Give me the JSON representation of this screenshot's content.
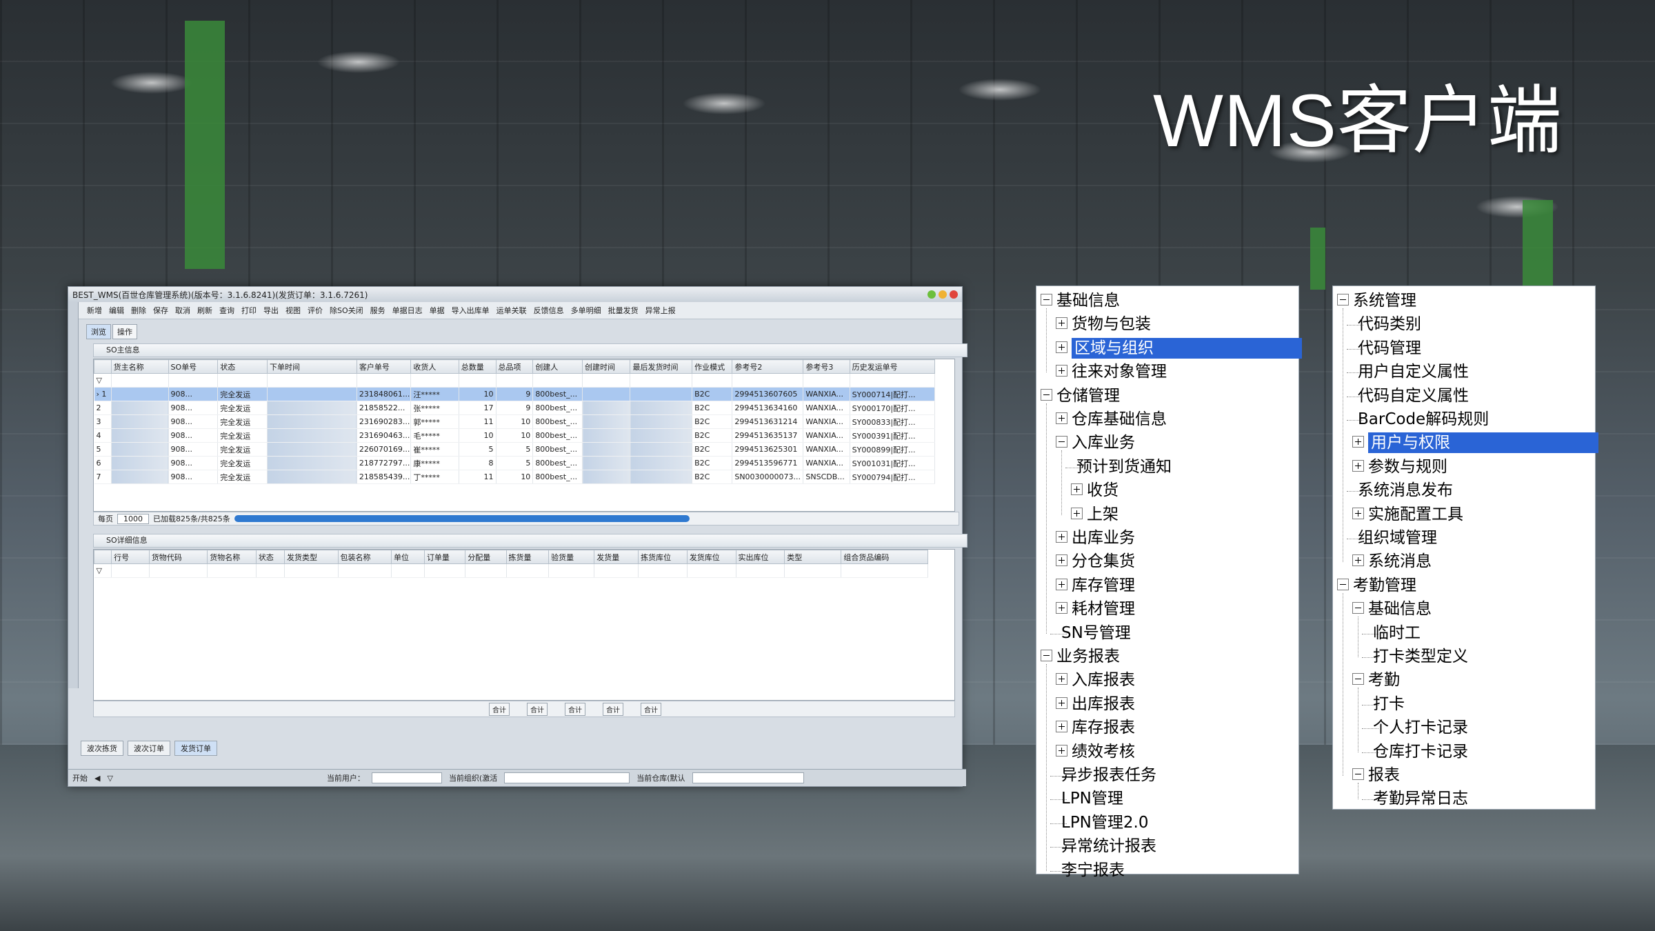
{
  "headline": "WMS客户端",
  "app": {
    "title": "BEST_WMS(百世仓库管理系统)(版本号：3.1.6.8241)(发货订单：3.1.6.7261)",
    "toolbar": [
      "新增",
      "编辑",
      "删除",
      "保存",
      "取消",
      "刷新",
      "查询",
      "打印",
      "导出",
      "视图",
      "评价",
      "除SO关闭",
      "服务",
      "单据日志",
      "单据",
      "导入出库单",
      "运单关联",
      "反馈信息",
      "多单明细",
      "批量发货",
      "异常上报"
    ],
    "subtabs": [
      "浏览",
      "操作"
    ],
    "so_header_section": "SO主信息",
    "so_columns": [
      "",
      "货主名称",
      "SO单号",
      "状态",
      "下单时间",
      "客户单号",
      "收货人",
      "总数量",
      "总品项",
      "创建人",
      "创建时间",
      "最后发货时间",
      "作业模式",
      "参考号2",
      "参考号3",
      "历史发运单号"
    ],
    "so_rows": [
      {
        "idx": "1",
        "so": "908...",
        "status": "完全发运",
        "cust": "231848061...",
        "recv": "汪*****",
        "qty": "10",
        "items": "9",
        "creator": "800best_...",
        "mode": "B2C",
        "ref2": "2994513607605",
        "ref3": "WANXIA...",
        "hist": "SY000714|配打..."
      },
      {
        "idx": "2",
        "so": "908...",
        "status": "完全发运",
        "cust": "21858522...",
        "recv": "张*****",
        "qty": "17",
        "items": "9",
        "creator": "800best_...",
        "mode": "B2C",
        "ref2": "2994513634160",
        "ref3": "WANXIA...",
        "hist": "SY000170|配打..."
      },
      {
        "idx": "3",
        "so": "908...",
        "status": "完全发运",
        "cust": "231690283...",
        "recv": "郭*****",
        "qty": "11",
        "items": "10",
        "creator": "800best_...",
        "mode": "B2C",
        "ref2": "2994513631214",
        "ref3": "WANXIA...",
        "hist": "SY000833|配打..."
      },
      {
        "idx": "4",
        "so": "908...",
        "status": "完全发运",
        "cust": "231690463...",
        "recv": "毛*****",
        "qty": "10",
        "items": "10",
        "creator": "800best_...",
        "mode": "B2C",
        "ref2": "2994513635137",
        "ref3": "WANXIA...",
        "hist": "SY000391|配打..."
      },
      {
        "idx": "5",
        "so": "908...",
        "status": "完全发运",
        "cust": "226070169...",
        "recv": "崔*****",
        "qty": "5",
        "items": "5",
        "creator": "800best_...",
        "mode": "B2C",
        "ref2": "2994513625301",
        "ref3": "WANXIA...",
        "hist": "SY000899|配打..."
      },
      {
        "idx": "6",
        "so": "908...",
        "status": "完全发运",
        "cust": "218772797...",
        "recv": "康*****",
        "qty": "8",
        "items": "5",
        "creator": "800best_...",
        "mode": "B2C",
        "ref2": "2994513596771",
        "ref3": "WANXIA...",
        "hist": "SY001031|配打..."
      },
      {
        "idx": "7",
        "so": "908...",
        "status": "完全发运",
        "cust": "218585439...",
        "recv": "丁*****",
        "qty": "11",
        "items": "10",
        "creator": "800best_...",
        "mode": "B2C",
        "ref2": "SN0030000073...",
        "ref3": "SNSCDB...",
        "hist": "SY000794|配打..."
      }
    ],
    "pager": {
      "label": "每页",
      "size": "1000",
      "loaded": "已加载825条/共825条"
    },
    "so_detail_section": "SO详细信息",
    "detail_columns": [
      "",
      "行号",
      "货物代码",
      "货物名称",
      "状态",
      "发货类型",
      "包装名称",
      "单位",
      "订单量",
      "分配量",
      "拣货量",
      "验货量",
      "发货量",
      "拣货库位",
      "发货库位",
      "实出库位",
      "类型",
      "组合货品编码"
    ],
    "sum_buttons": [
      "合计",
      "合计",
      "合计",
      "合计",
      "合计"
    ],
    "doc_tabs": [
      "波次拣货",
      "波次订单",
      "发货订单"
    ],
    "status": {
      "start": "开始",
      "user": "当前用户：",
      "org": "当前组织(激活",
      "warehouse": "当前仓库(默认"
    }
  },
  "tree_left": [
    {
      "label": "基础信息",
      "level": 0,
      "toggle": "minus"
    },
    {
      "label": "货物与包装",
      "level": 1,
      "toggle": "plus"
    },
    {
      "label": "区域与组织",
      "level": 1,
      "toggle": "plus",
      "selected": true
    },
    {
      "label": "往来对象管理",
      "level": 1,
      "toggle": "plus"
    },
    {
      "label": "仓储管理",
      "level": 0,
      "toggle": "minus"
    },
    {
      "label": "仓库基础信息",
      "level": 1,
      "toggle": "plus"
    },
    {
      "label": "入库业务",
      "level": 1,
      "toggle": "minus"
    },
    {
      "label": "预计到货通知",
      "level": 2,
      "toggle": "none"
    },
    {
      "label": "收货",
      "level": 2,
      "toggle": "plus"
    },
    {
      "label": "上架",
      "level": 2,
      "toggle": "plus"
    },
    {
      "label": "出库业务",
      "level": 1,
      "toggle": "plus"
    },
    {
      "label": "分仓集货",
      "level": 1,
      "toggle": "plus"
    },
    {
      "label": "库存管理",
      "level": 1,
      "toggle": "plus"
    },
    {
      "label": "耗材管理",
      "level": 1,
      "toggle": "plus"
    },
    {
      "label": "SN号管理",
      "level": 1,
      "toggle": "none"
    },
    {
      "label": "业务报表",
      "level": 0,
      "toggle": "minus"
    },
    {
      "label": "入库报表",
      "level": 1,
      "toggle": "plus"
    },
    {
      "label": "出库报表",
      "level": 1,
      "toggle": "plus"
    },
    {
      "label": "库存报表",
      "level": 1,
      "toggle": "plus"
    },
    {
      "label": "绩效考核",
      "level": 1,
      "toggle": "plus"
    },
    {
      "label": "异步报表任务",
      "level": 1,
      "toggle": "none"
    },
    {
      "label": "LPN管理",
      "level": 1,
      "toggle": "none"
    },
    {
      "label": "LPN管理2.0",
      "level": 1,
      "toggle": "none"
    },
    {
      "label": "异常统计报表",
      "level": 1,
      "toggle": "none"
    },
    {
      "label": "李宁报表",
      "level": 1,
      "toggle": "none"
    }
  ],
  "tree_right": [
    {
      "label": "系统管理",
      "level": 0,
      "toggle": "minus"
    },
    {
      "label": "代码类别",
      "level": 1,
      "toggle": "none"
    },
    {
      "label": "代码管理",
      "level": 1,
      "toggle": "none"
    },
    {
      "label": "用户自定义属性",
      "level": 1,
      "toggle": "none"
    },
    {
      "label": "代码自定义属性",
      "level": 1,
      "toggle": "none"
    },
    {
      "label": "BarCode解码规则",
      "level": 1,
      "toggle": "none"
    },
    {
      "label": "用户与权限",
      "level": 1,
      "toggle": "plus",
      "selected": true
    },
    {
      "label": "参数与规则",
      "level": 1,
      "toggle": "plus"
    },
    {
      "label": "系统消息发布",
      "level": 1,
      "toggle": "none"
    },
    {
      "label": "实施配置工具",
      "level": 1,
      "toggle": "plus"
    },
    {
      "label": "组织域管理",
      "level": 1,
      "toggle": "none"
    },
    {
      "label": "系统消息",
      "level": 1,
      "toggle": "plus"
    },
    {
      "label": "考勤管理",
      "level": 0,
      "toggle": "minus"
    },
    {
      "label": "基础信息",
      "level": 1,
      "toggle": "minus"
    },
    {
      "label": "临时工",
      "level": 2,
      "toggle": "none"
    },
    {
      "label": "打卡类型定义",
      "level": 2,
      "toggle": "none"
    },
    {
      "label": "考勤",
      "level": 1,
      "toggle": "minus"
    },
    {
      "label": "打卡",
      "level": 2,
      "toggle": "none"
    },
    {
      "label": "个人打卡记录",
      "level": 2,
      "toggle": "none"
    },
    {
      "label": "仓库打卡记录",
      "level": 2,
      "toggle": "none"
    },
    {
      "label": "报表",
      "level": 1,
      "toggle": "minus"
    },
    {
      "label": "考勤异常日志",
      "level": 2,
      "toggle": "none"
    }
  ]
}
